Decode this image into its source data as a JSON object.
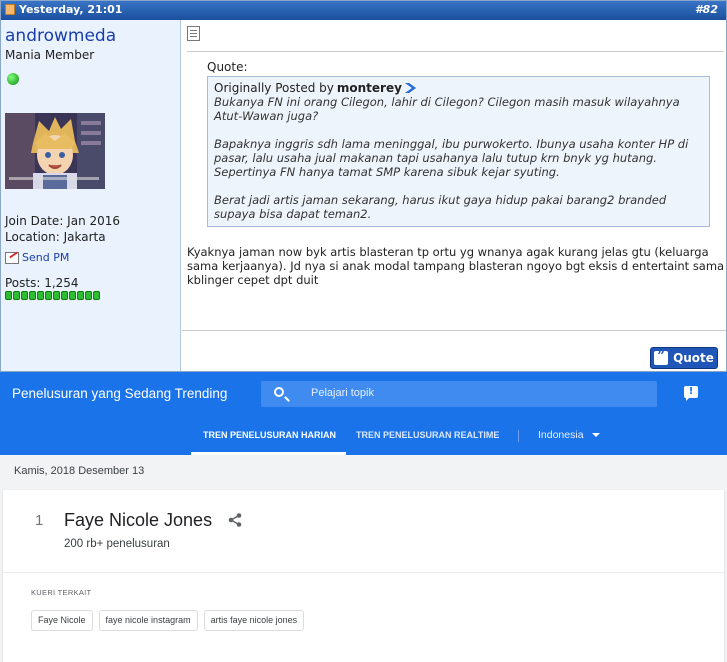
{
  "post": {
    "date": "Yesterday, 21:01",
    "number": "#82",
    "user": {
      "name": "androwmeda",
      "title": "Mania Member",
      "join_date": "Join Date: Jan 2016",
      "location": "Location: Jakarta",
      "send_pm": "Send PM",
      "posts": "Posts: 1,254",
      "reputation_blocks": 12
    },
    "quote_label": "Quote:",
    "quote": {
      "prefix": "Originally Posted by",
      "author": "monterey",
      "paragraphs": [
        "Bukanya FN ini orang Cilegon, lahir di Cilegon? Cilegon masih masuk wilayahnya Atut-Wawan juga?",
        "Bapaknya inggris sdh lama meninggal, ibu purwokerto. Ibunya usaha konter HP di pasar, lalu usaha jual makanan tapi usahanya lalu tutup krn bnyk yg hutang.\nSepertinya FN hanya tamat SMP karena sibuk kejar syuting.",
        "Berat jadi artis jaman sekarang, harus ikut gaya hidup pakai barang2 branded supaya bisa dapat teman2."
      ]
    },
    "reply": "Kyaknya jaman now byk artis blasteran tp ortu yg wnanya agak kurang jelas gtu (keluarga sama kerjaanya). Jd nya si anak modal tampang blasteran ngoyo bgt eksis d entertaint sama kblinger cepet dpt duit",
    "quote_button": "Quote"
  },
  "trends": {
    "title": "Penelusuran yang Sedang Trending",
    "search_placeholder": "Pelajari topik",
    "tabs": [
      "TREN PENELUSURAN HARIAN",
      "TREN PENELUSURAN REALTIME"
    ],
    "country": "Indonesia",
    "date": "Kamis, 2018 Desember 13",
    "item": {
      "rank": "1",
      "topic": "Faye Nicole Jones",
      "searches": "200 rb+ penelusuran",
      "related_label": "KUERI TERKAIT",
      "related": [
        "Faye Nicole",
        "faye nicole instagram",
        "artis faye nicole jones"
      ]
    },
    "colors": {
      "header_blue": "#1a73e8",
      "forum_blue": "#1b4f9e"
    }
  }
}
